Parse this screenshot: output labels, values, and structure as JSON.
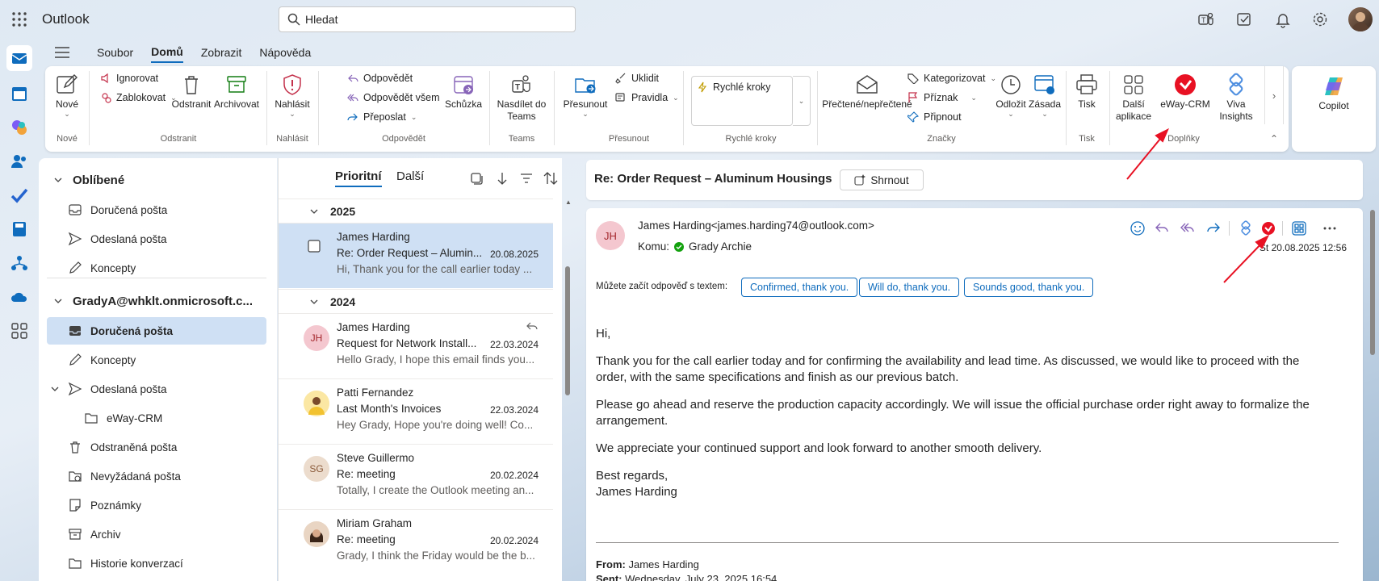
{
  "app": {
    "name": "Outlook"
  },
  "search": {
    "placeholder": "Hledat"
  },
  "ribbon": {
    "tabs": [
      "Soubor",
      "Domů",
      "Zobrazit",
      "Nápověda"
    ],
    "active_tab": "Domů",
    "new": {
      "label": "Nové",
      "group": "Nové"
    },
    "odstranit": {
      "ignore": "Ignorovat",
      "block": "Zablokovat",
      "delete": "Odstranit",
      "archive": "Archivovat",
      "group": "Odstranit"
    },
    "nahlasit": {
      "label": "Nahlásit",
      "group": "Nahlásit"
    },
    "odpovedet": {
      "reply": "Odpovědět",
      "reply_all": "Odpovědět všem",
      "forward": "Přeposlat",
      "meeting": "Schůzka",
      "group": "Odpovědět"
    },
    "teams": {
      "share": "Nasdílet do",
      "share2": "Teams",
      "group": "Teams"
    },
    "presunout": {
      "move": "Přesunout",
      "sweep": "Uklidit",
      "rules": "Pravidla",
      "group": "Přesunout"
    },
    "quick": {
      "label": "Rychlé kroky",
      "group": "Rychlé kroky"
    },
    "znacky": {
      "read_unread": "Přečtené/nepřečtené",
      "categorize": "Kategorizovat",
      "flag": "Příznak",
      "pin": "Připnout",
      "snooze": "Odložit",
      "policy": "Zásada",
      "group": "Značky"
    },
    "tisk": {
      "label": "Tisk",
      "group": "Tisk"
    },
    "doplnky": {
      "more1": "Další",
      "more2": "aplikace",
      "eway": "eWay-CRM",
      "viva1": "Viva",
      "viva2": "Insights",
      "group": "Doplňky"
    },
    "copilot": {
      "label": "Copilot"
    }
  },
  "folders": {
    "favorites_header": "Oblíbené",
    "favorites": [
      "Doručená pošta",
      "Odeslaná pošta",
      "Koncepty"
    ],
    "account": "GradyA@whklt.onmicrosoft.c...",
    "items": [
      "Doručená pošta",
      "Koncepty",
      "Odeslaná pošta",
      "eWay-CRM",
      "Odstraněná pošta",
      "Nevyžádaná pošta",
      "Poznámky",
      "Archiv",
      "Historie konverzací"
    ]
  },
  "list": {
    "tab_focused": "Prioritní",
    "tab_other": "Další",
    "groups": [
      "2025",
      "2024"
    ],
    "messages": [
      {
        "from": "James Harding",
        "subject": "Re: Order Request – Alumin...",
        "date": "20.08.2025",
        "preview": "Hi, Thank you for the call earlier today ..."
      },
      {
        "from": "James Harding",
        "initials": "JH",
        "subject": "Request for Network Install...",
        "date": "22.03.2024",
        "preview": "Hello Grady, I hope this email finds you..."
      },
      {
        "from": "Patti Fernandez",
        "subject": "Last Month's Invoices",
        "date": "22.03.2024",
        "preview": "Hey Grady, Hope you're doing well! Co..."
      },
      {
        "from": "Steve Guillermo",
        "initials": "SG",
        "subject": "Re: meeting",
        "date": "20.02.2024",
        "preview": "Totally, I create the Outlook meeting an..."
      },
      {
        "from": "Miriam Graham",
        "subject": "Re: meeting",
        "date": "20.02.2024",
        "preview": "Grady, I think the Friday would be the b..."
      }
    ]
  },
  "reading": {
    "subject": "Re: Order Request – Aluminum Housings",
    "summarize": "Shrnout",
    "sender_initials": "JH",
    "sender": "James Harding<james.harding74@outlook.com>",
    "to_label": "Komu:",
    "to": "Grady Archie",
    "date": "St 20.08.2025 12:56",
    "suggest_label": "Můžete začít odpověď s textem:",
    "suggestions": [
      "Confirmed, thank you.",
      "Will do, thank you.",
      "Sounds good, thank you."
    ],
    "body": [
      "Hi,",
      "Thank you for the call earlier today and for confirming the availability and lead time. As discussed, we would like to proceed with the",
      "order, with the same specifications and finish as our previous batch.",
      "Please go ahead and reserve the production capacity accordingly. We will issue the official purchase order right away to formalize the",
      "arrangement.",
      "We appreciate your continued support and look forward to another smooth delivery.",
      "Best regards,",
      "James Harding"
    ],
    "quoted_from_label": "From:",
    "quoted_from": "James Harding",
    "quoted_sent_label": "Sent:",
    "quoted_sent": "Wednesday, July 23, 2025 16:54"
  },
  "colors": {
    "accent": "#0f6cbd",
    "selected": "#cfe0f4",
    "arrow": "#e81123",
    "eway": "#e81123"
  }
}
